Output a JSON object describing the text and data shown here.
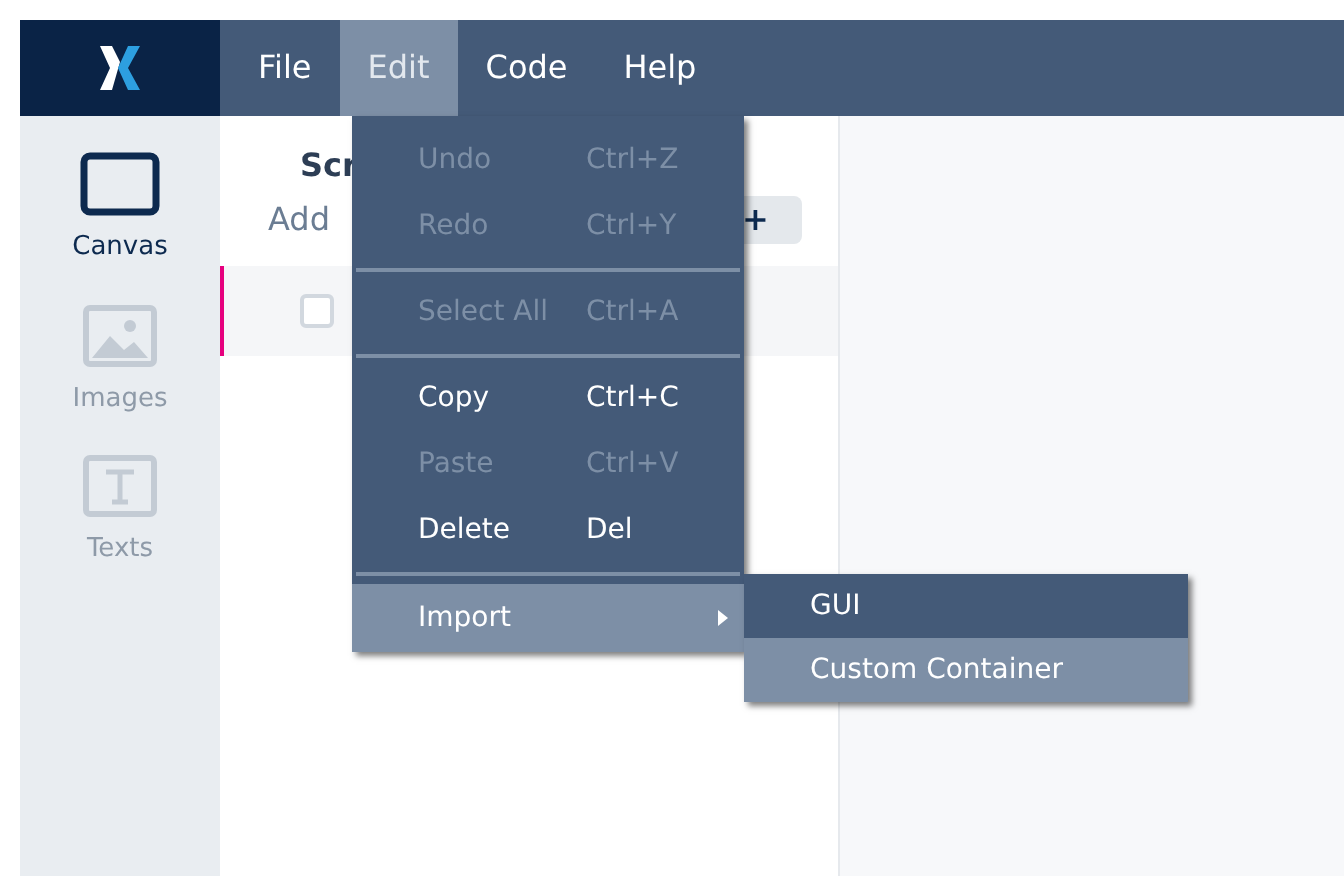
{
  "menubar": [
    {
      "label": "File",
      "selected": false
    },
    {
      "label": "Edit",
      "selected": true
    },
    {
      "label": "Code",
      "selected": false
    },
    {
      "label": "Help",
      "selected": false
    }
  ],
  "sidebar": {
    "items": [
      {
        "label": "Canvas",
        "kind": "canvas",
        "selected": true
      },
      {
        "label": "Images",
        "kind": "images",
        "selected": false
      },
      {
        "label": "Texts",
        "kind": "texts",
        "selected": false
      }
    ]
  },
  "panel": {
    "title": "Scr",
    "add_label": "Add",
    "add_button": "+",
    "rows": [
      {
        "checked": false,
        "selected": true
      }
    ]
  },
  "edit_menu": [
    {
      "kind": "item",
      "label": "Undo",
      "shortcut": "Ctrl+Z",
      "disabled": true,
      "selected": false
    },
    {
      "kind": "item",
      "label": "Redo",
      "shortcut": "Ctrl+Y",
      "disabled": true,
      "selected": false
    },
    {
      "kind": "separator"
    },
    {
      "kind": "item",
      "label": "Select All",
      "shortcut": "Ctrl+A",
      "disabled": true,
      "selected": false
    },
    {
      "kind": "separator"
    },
    {
      "kind": "item",
      "label": "Copy",
      "shortcut": "Ctrl+C",
      "disabled": false,
      "selected": false
    },
    {
      "kind": "item",
      "label": "Paste",
      "shortcut": "Ctrl+V",
      "disabled": true,
      "selected": false
    },
    {
      "kind": "item",
      "label": "Delete",
      "shortcut": "Del",
      "disabled": false,
      "selected": false
    },
    {
      "kind": "separator"
    },
    {
      "kind": "submenu",
      "label": "Import",
      "disabled": false,
      "selected": true
    }
  ],
  "import_submenu": [
    {
      "label": "GUI",
      "selected": false
    },
    {
      "label": "Custom Container",
      "selected": true
    }
  ]
}
